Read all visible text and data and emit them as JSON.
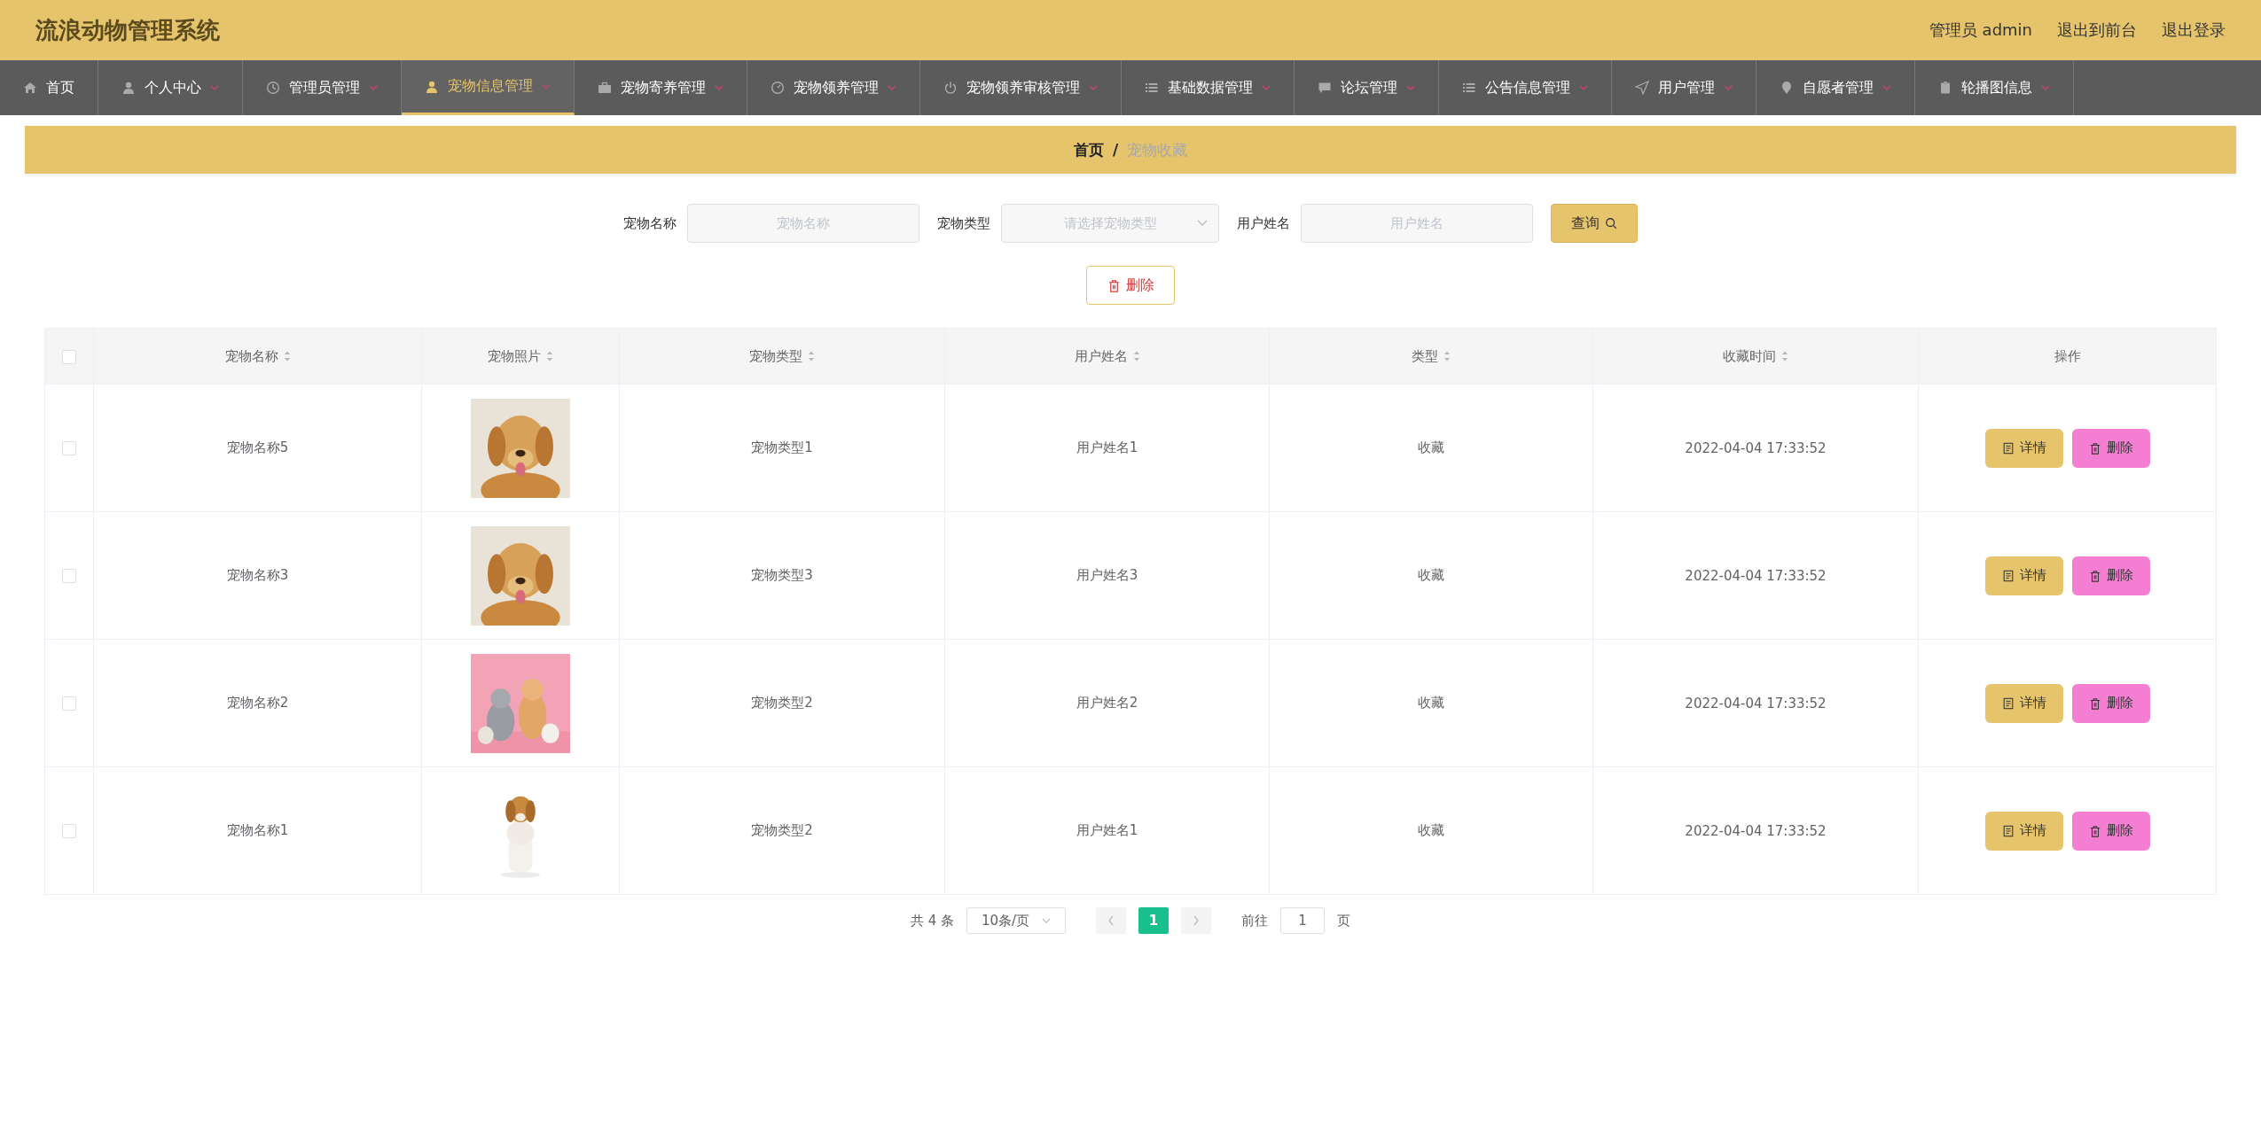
{
  "header": {
    "title": "流浪动物管理系统",
    "links": [
      "管理员 admin",
      "退出到前台",
      "退出登录"
    ]
  },
  "nav": [
    {
      "label": "首页",
      "selected": false,
      "dropdown": false
    },
    {
      "label": "个人中心",
      "selected": false,
      "dropdown": true
    },
    {
      "label": "管理员管理",
      "selected": false,
      "dropdown": true
    },
    {
      "label": "宠物信息管理",
      "selected": true,
      "dropdown": true
    },
    {
      "label": "宠物寄养管理",
      "selected": false,
      "dropdown": true
    },
    {
      "label": "宠物领养管理",
      "selected": false,
      "dropdown": true
    },
    {
      "label": "宠物领养审核管理",
      "selected": false,
      "dropdown": true
    },
    {
      "label": "基础数据管理",
      "selected": false,
      "dropdown": true
    },
    {
      "label": "论坛管理",
      "selected": false,
      "dropdown": true
    },
    {
      "label": "公告信息管理",
      "selected": false,
      "dropdown": true
    },
    {
      "label": "用户管理",
      "selected": false,
      "dropdown": true
    },
    {
      "label": "自愿者管理",
      "selected": false,
      "dropdown": true
    },
    {
      "label": "轮播图信息",
      "selected": false,
      "dropdown": true
    }
  ],
  "breadcrumb": {
    "home": "首页",
    "separator": "/",
    "current": "宠物收藏"
  },
  "search": {
    "fields": [
      {
        "kind": "input",
        "label": "宠物名称",
        "placeholder": "宠物名称"
      },
      {
        "kind": "select",
        "label": "宠物类型",
        "placeholder": "请选择宠物类型"
      },
      {
        "kind": "input",
        "label": "用户姓名",
        "placeholder": "用户姓名"
      }
    ],
    "button": "查询"
  },
  "delete_button": "删除",
  "table": {
    "select_all_checked": false,
    "columns": [
      {
        "label": "宠物名称",
        "sortable": true
      },
      {
        "label": "宠物照片",
        "sortable": true
      },
      {
        "label": "宠物类型",
        "sortable": true
      },
      {
        "label": "用户姓名",
        "sortable": true
      },
      {
        "label": "类型",
        "sortable": true
      },
      {
        "label": "收藏时间",
        "sortable": true
      },
      {
        "label": "操作",
        "sortable": false
      }
    ],
    "rows": [
      {
        "checked": false,
        "name": "宠物名称5",
        "photo": {
          "kind": "picture"
        },
        "type": "宠物类型1",
        "user": "用户姓名1",
        "kind": "收藏",
        "time": "2022-04-04 17:33:52",
        "actions": [
          "详情",
          "删除"
        ]
      },
      {
        "checked": false,
        "name": "宠物名称3",
        "photo": {
          "kind": "picture"
        },
        "type": "宠物类型3",
        "user": "用户姓名3",
        "kind": "收藏",
        "time": "2022-04-04 17:33:52",
        "actions": [
          "详情",
          "删除"
        ]
      },
      {
        "checked": false,
        "name": "宠物名称2",
        "photo": {
          "kind": "picture"
        },
        "type": "宠物类型2",
        "user": "用户姓名2",
        "kind": "收藏",
        "time": "2022-04-04 17:33:52",
        "actions": [
          "详情",
          "删除"
        ]
      },
      {
        "checked": false,
        "name": "宠物名称1",
        "photo": {
          "kind": "picture"
        },
        "type": "宠物类型2",
        "user": "用户姓名1",
        "kind": "收藏",
        "time": "2022-04-04 17:33:52",
        "actions": [
          "详情",
          "删除"
        ]
      }
    ]
  },
  "pagination": {
    "total": "共 4 条",
    "page_size": "10条/页",
    "pages": [
      {
        "label": "1",
        "selected": true
      }
    ],
    "goto_label": "前往",
    "goto_value": "1",
    "goto_suffix": "页"
  }
}
